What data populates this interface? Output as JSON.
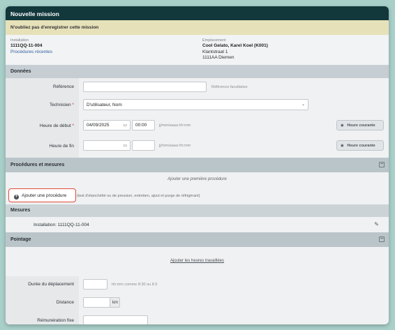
{
  "header": {
    "title": "Nouvelle mission"
  },
  "notice": {
    "text": "N'oubliez pas d'enregistrer cette mission"
  },
  "installation": {
    "label": "Installation",
    "value": "1111QQ-11-004",
    "link": "Procédures récentes"
  },
  "location": {
    "label": "Emplacement",
    "name": "Cool Gelato, Karel Koel (K001)",
    "street": "Klantstraat 1",
    "city": "1111AA Diemen"
  },
  "donnees": {
    "title": "Données",
    "reference": {
      "label": "Référence",
      "value": "",
      "hint": "Référence facultative"
    },
    "technicien": {
      "label": "Technicien",
      "required_mark": "*",
      "value": "D'utilisateur, Nom"
    },
    "start": {
      "label": "Heure de début",
      "required_mark": "*",
      "date": "04/09/2025",
      "time": "00:00",
      "hint": "jj/mm/aaaa hh:mm",
      "button": "Heure courante"
    },
    "end": {
      "label": "Heure de fin",
      "date": "",
      "time": "",
      "hint": "jj/mm/aaaa hh:mm",
      "button": "Heure courante"
    }
  },
  "procedures": {
    "title": "Procédures et mesures",
    "collapse_symbol": "−",
    "empty_text": "Ajouter une première procédure",
    "add_button": "Ajouter une procédure",
    "add_hint": "(test d'étanchéité ou de pression, entretien, ajout et purge de réfrigérant)"
  },
  "mesures": {
    "title": "Mesures",
    "item": "Installation: 1111QQ-11-004"
  },
  "pointage": {
    "title": "Pointage",
    "collapse_symbol": "−",
    "add_link": "Ajouter les heures travaillées",
    "duration": {
      "label": "Durée du déplacement",
      "value": "",
      "hint": "hh:mm comme 8:30 ou 8.5"
    },
    "distance": {
      "label": "Distance",
      "value": "",
      "unit": "km"
    },
    "remuneration": {
      "label": "Rémunération fixe",
      "value": ""
    }
  },
  "colors": {
    "background": "#a9cfc9",
    "titlebar": "#12383c",
    "notice": "#e7e1b9",
    "section": "#c6ced3",
    "highlight": "#e04a3a",
    "link": "#2f5d9e"
  }
}
